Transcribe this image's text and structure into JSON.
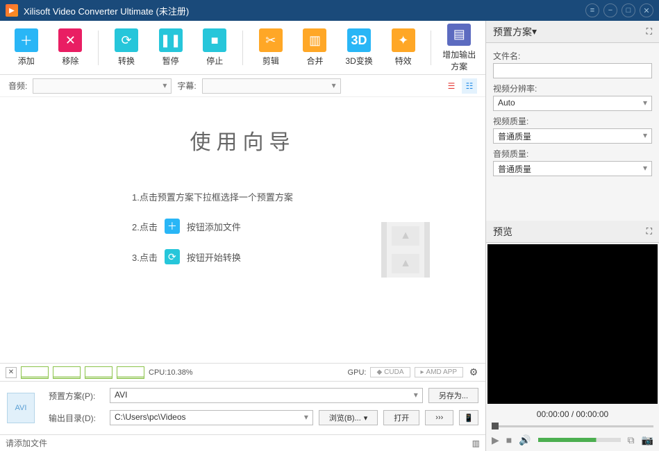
{
  "window": {
    "title": "Xilisoft Video Converter Ultimate (未注册)"
  },
  "toolbar": {
    "add": "添加",
    "remove": "移除",
    "convert": "转换",
    "pause": "暂停",
    "stop": "停止",
    "cut": "剪辑",
    "merge": "合并",
    "3d": "3D变换",
    "fx": "特效",
    "output": "增加输出方案"
  },
  "subbar": {
    "audio_lbl": "音频:",
    "subtitle_lbl": "字幕:"
  },
  "wizard": {
    "title": "使用向导",
    "step1": "1.点击预置方案下拉框选择一个预置方案",
    "step2_pre": "2.点击",
    "step2_post": "按钮添加文件",
    "step3_pre": "3.点击",
    "step3_post": "按钮开始转换"
  },
  "cpu": {
    "label": "CPU:10.38%",
    "gpu_label": "GPU:",
    "cuda": "CUDA",
    "amd": "AMD APP"
  },
  "bottom": {
    "profile_lbl": "预置方案(P):",
    "profile_val": "AVI",
    "saveas": "另存为...",
    "outdir_lbl": "输出目录(D):",
    "outdir_val": "C:\\Users\\pc\\Videos",
    "browse": "浏览(B)...",
    "open": "打开"
  },
  "status": {
    "text": "请添加文件"
  },
  "right": {
    "preset_title": "预置方案",
    "filename": "文件名:",
    "vres": "视频分辨率:",
    "vres_val": "Auto",
    "vq": "视频质量:",
    "vq_val": "普通质量",
    "aq": "音频质量:",
    "aq_val": "普通质量",
    "preview_title": "预览",
    "time": "00:00:00 / 00:00:00"
  }
}
